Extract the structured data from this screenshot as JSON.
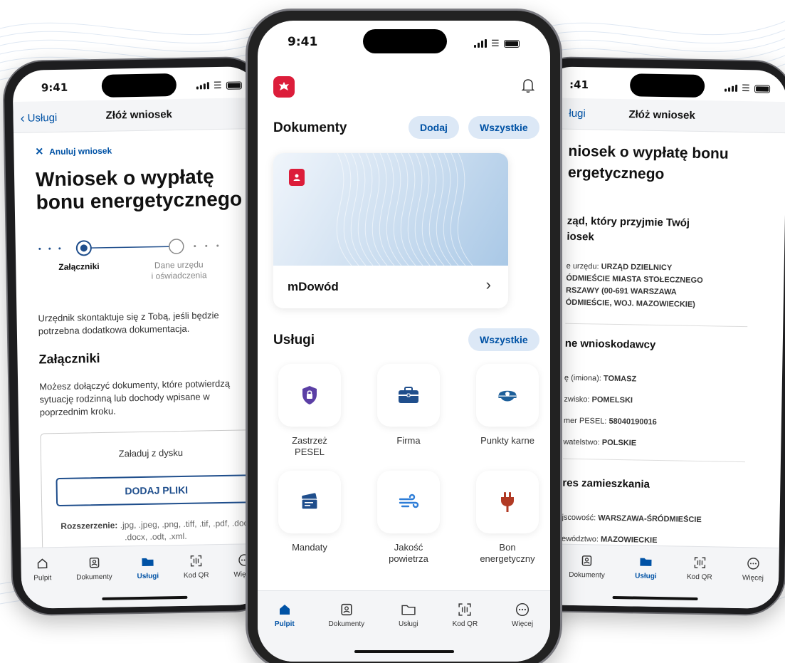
{
  "status_time": "9:41",
  "left_phone": {
    "nav_back": "Usługi",
    "nav_title": "Złóż wniosek",
    "cancel_link": "Anuluj wniosek",
    "heading": "Wniosek o wypłatę bonu energetycznego",
    "step_current": "Załączniki",
    "step_next_line1": "Dane urzędu",
    "step_next_line2": "i oświadczenia",
    "info_text": "Urzędnik skontaktuje się z Tobą, jeśli będzie potrzebna dodatkowa dokumentacja.",
    "section_title": "Załączniki",
    "section_text": "Możesz dołączyć dokumenty, które potwierdzą sytuację rodzinną lub dochody wpisane w poprzednim kroku.",
    "upload_title": "Załaduj z dysku",
    "upload_button": "DODAJ PLIKI",
    "ext_label": "Rozszerzenie:",
    "ext_values": ".jpg, .jpeg, .png, .tiff, .tif, .pdf, .doc, .docx, .odt, .xml.",
    "tabs": [
      "Pulpit",
      "Dokumenty",
      "Usługi",
      "Kod QR",
      "Więcej"
    ]
  },
  "center_phone": {
    "documents_title": "Dokumenty",
    "add_button": "Dodaj",
    "all_button": "Wszystkie",
    "card_name": "mDowód",
    "services_title": "Usługi",
    "services_all_button": "Wszystkie",
    "services": [
      {
        "label": "Zastrzeż PESEL",
        "icon": "shield-lock-icon",
        "color": "#5b3fa5"
      },
      {
        "label": "Firma",
        "icon": "briefcase-icon",
        "color": "#1f4e8c"
      },
      {
        "label": "Punkty karne",
        "icon": "police-cap-icon",
        "color": "#1d5f9a"
      },
      {
        "label": "Mandaty",
        "icon": "tickets-icon",
        "color": "#1f4e8c"
      },
      {
        "label": "Jakość powietrza",
        "icon": "wind-icon",
        "color": "#2e7dd7"
      },
      {
        "label": "Bon energetyczny",
        "icon": "plug-icon",
        "color": "#b13a24"
      }
    ],
    "tabs": [
      "Pulpit",
      "Dokumenty",
      "Usługi",
      "Kod QR",
      "Więcej"
    ]
  },
  "right_phone": {
    "status_time": ":41",
    "nav_back": "ługi",
    "nav_title": "Złóż wniosek",
    "heading_line1": "niosek o wypłatę bonu",
    "heading_line2": "ergetycznego",
    "section1_line1": "ząd, który przyjmie Twój",
    "section1_line2": "iosek",
    "office_label": "e urzędu:",
    "office_value_line1": "URZĄD DZIELNICY",
    "office_value_line2": "ÓDMIEŚCIE MIASTA STOŁECZNEGO",
    "office_value_line3": "RSZAWY (00-691 WARSZAWA",
    "office_value_line4": "ÓDMIEŚCIE, WOJ. MAZOWIECKIE)",
    "section2": "ne wnioskodawcy",
    "name_label": "ę (imiona):",
    "name_value": "TOMASZ",
    "surname_label": "zwisko:",
    "surname_value": "POMELSKI",
    "pesel_label": "mer PESEL:",
    "pesel_value": "58040190016",
    "citizenship_label": "watelstwo:",
    "citizenship_value": "POLSKIE",
    "section3": "res zamieszkania",
    "city_label": "jscowość:",
    "city_value": "WARSZAWA-ŚRÓDMIEŚCIE",
    "province_label": "ewództwo:",
    "province_value": "MAZOWIECKIE",
    "tabs": [
      "Dokumenty",
      "Usługi",
      "Kod QR",
      "Więcej"
    ]
  }
}
